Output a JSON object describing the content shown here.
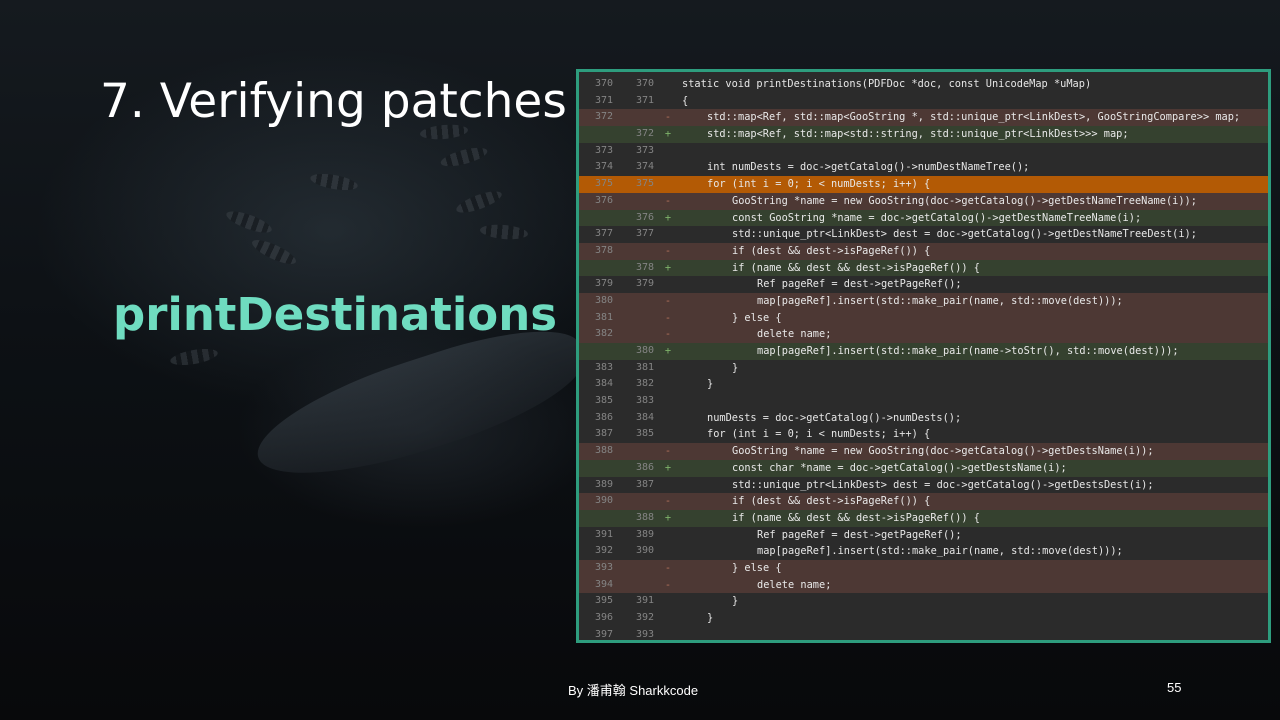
{
  "slide": {
    "title": "7. Verifying patches",
    "subtitle": "printDestinations",
    "footer_author": "By 潘甫翰 Sharkkcode",
    "slide_number": "55",
    "accent_color": "#6fdcc0",
    "frame_color": "#2e9d7e"
  },
  "diff": {
    "lines": [
      {
        "old": "370",
        "new": "370",
        "type": "ctx",
        "indent": 0,
        "code": "static void printDestinations(PDFDoc *doc, const UnicodeMap *uMap)"
      },
      {
        "old": "371",
        "new": "371",
        "type": "ctx",
        "indent": 0,
        "code": "{"
      },
      {
        "old": "372",
        "new": "",
        "type": "del",
        "indent": 1,
        "code": "std::map<Ref, std::map<GooString *, std::unique_ptr<LinkDest>, GooStringCompare>> map;"
      },
      {
        "old": "",
        "new": "372",
        "type": "add",
        "indent": 1,
        "code": "std::map<Ref, std::map<std::string, std::unique_ptr<LinkDest>>> map;"
      },
      {
        "old": "373",
        "new": "373",
        "type": "ctx",
        "indent": 0,
        "code": ""
      },
      {
        "old": "374",
        "new": "374",
        "type": "ctx",
        "indent": 1,
        "code": "int numDests = doc->getCatalog()->numDestNameTree();"
      },
      {
        "old": "375",
        "new": "375",
        "type": "hl",
        "indent": 1,
        "code": "for (int i = 0; i < numDests; i++) {"
      },
      {
        "old": "376",
        "new": "",
        "type": "del",
        "indent": 2,
        "code": "GooString *name = new GooString(doc->getCatalog()->getDestNameTreeName(i));"
      },
      {
        "old": "",
        "new": "376",
        "type": "add",
        "indent": 2,
        "code": "const GooString *name = doc->getCatalog()->getDestNameTreeName(i);"
      },
      {
        "old": "377",
        "new": "377",
        "type": "ctx",
        "indent": 2,
        "code": "std::unique_ptr<LinkDest> dest = doc->getCatalog()->getDestNameTreeDest(i);"
      },
      {
        "old": "378",
        "new": "",
        "type": "del",
        "indent": 2,
        "code": "if (dest && dest->isPageRef()) {"
      },
      {
        "old": "",
        "new": "378",
        "type": "add",
        "indent": 2,
        "code": "if (name && dest && dest->isPageRef()) {"
      },
      {
        "old": "379",
        "new": "379",
        "type": "ctx",
        "indent": 3,
        "code": "Ref pageRef = dest->getPageRef();"
      },
      {
        "old": "380",
        "new": "",
        "type": "del",
        "indent": 3,
        "code": "map[pageRef].insert(std::make_pair(name, std::move(dest)));"
      },
      {
        "old": "381",
        "new": "",
        "type": "del",
        "indent": 2,
        "code": "} else {"
      },
      {
        "old": "382",
        "new": "",
        "type": "del",
        "indent": 3,
        "code": "delete name;"
      },
      {
        "old": "",
        "new": "380",
        "type": "add",
        "indent": 3,
        "code": "map[pageRef].insert(std::make_pair(name->toStr(), std::move(dest)));"
      },
      {
        "old": "383",
        "new": "381",
        "type": "ctx",
        "indent": 2,
        "code": "}"
      },
      {
        "old": "384",
        "new": "382",
        "type": "ctx",
        "indent": 1,
        "code": "}"
      },
      {
        "old": "385",
        "new": "383",
        "type": "ctx",
        "indent": 0,
        "code": ""
      },
      {
        "old": "386",
        "new": "384",
        "type": "ctx",
        "indent": 1,
        "code": "numDests = doc->getCatalog()->numDests();"
      },
      {
        "old": "387",
        "new": "385",
        "type": "ctx",
        "indent": 1,
        "code": "for (int i = 0; i < numDests; i++) {"
      },
      {
        "old": "388",
        "new": "",
        "type": "del",
        "indent": 2,
        "code": "GooString *name = new GooString(doc->getCatalog()->getDestsName(i));"
      },
      {
        "old": "",
        "new": "386",
        "type": "add",
        "indent": 2,
        "code": "const char *name = doc->getCatalog()->getDestsName(i);"
      },
      {
        "old": "389",
        "new": "387",
        "type": "ctx",
        "indent": 2,
        "code": "std::unique_ptr<LinkDest> dest = doc->getCatalog()->getDestsDest(i);"
      },
      {
        "old": "390",
        "new": "",
        "type": "del",
        "indent": 2,
        "code": "if (dest && dest->isPageRef()) {"
      },
      {
        "old": "",
        "new": "388",
        "type": "add",
        "indent": 2,
        "code": "if (name && dest && dest->isPageRef()) {"
      },
      {
        "old": "391",
        "new": "389",
        "type": "ctx",
        "indent": 3,
        "code": "Ref pageRef = dest->getPageRef();"
      },
      {
        "old": "392",
        "new": "390",
        "type": "ctx",
        "indent": 3,
        "code": "map[pageRef].insert(std::make_pair(name, std::move(dest)));"
      },
      {
        "old": "393",
        "new": "",
        "type": "del",
        "indent": 2,
        "code": "} else {"
      },
      {
        "old": "394",
        "new": "",
        "type": "del",
        "indent": 3,
        "code": "delete name;"
      },
      {
        "old": "395",
        "new": "391",
        "type": "ctx",
        "indent": 2,
        "code": "}"
      },
      {
        "old": "396",
        "new": "392",
        "type": "ctx",
        "indent": 1,
        "code": "}"
      },
      {
        "old": "397",
        "new": "393",
        "type": "ctx",
        "indent": 0,
        "code": ""
      }
    ]
  }
}
